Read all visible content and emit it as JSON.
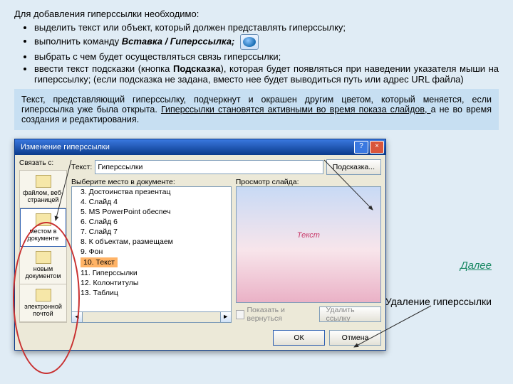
{
  "intro": {
    "title": "Для добавления гиперссылки необходимо:",
    "items": [
      "выделить текст или объект, который должен представлять гиперссылку;",
      "выполнить команду ",
      "выбрать с чем будет осуществляться связь гиперссылки;",
      "ввести текст подсказки (кнопка "
    ],
    "cmd": "Вставка / Гиперссылка;",
    "tipbtn": "Подсказка",
    "tiptail": "), которая будет появляться при наведении указателя мыши на гиперссылку; (если подсказка не задана, вместо нее будет выводиться путь или адрес URL файла)"
  },
  "note": {
    "t1": "Текст, представляющий гиперссылку, подчеркнут и окрашен другим цветом, который меняется, если гиперссылка уже была открыта. ",
    "t2": "Гиперссылки становятся активными во время показа слайдов, ",
    "t3": "а не во время создания и редактирования."
  },
  "dlg": {
    "title": "Изменение гиперссылки",
    "link_lbl": "Связать с:",
    "text_lbl": "Текст:",
    "text_val": "Гиперссылки",
    "tip_btn": "Подсказка...",
    "side": [
      {
        "l": "файлом, веб-\nстраницей"
      },
      {
        "l": "местом в\nдокументе"
      },
      {
        "l": "новым\nдокументом"
      },
      {
        "l": "электронной\nпочтой"
      }
    ],
    "tree_lbl": "Выберите место в документе:",
    "tree": [
      "3. Достоинства презентац",
      "4. Слайд 4",
      "5. MS PowerPoint обеспеч",
      "6. Слайд 6",
      "7. Слайд 7",
      "8. К объектам, размещаем",
      "9. Фон",
      "10. Текст",
      "11. Гиперссылки",
      "12. Колонтитулы",
      "13. Таблиц"
    ],
    "tree_sel": 7,
    "prev_lbl": "Просмотр слайда:",
    "prev_txt": "Текст",
    "chk_lbl": "Показать и вернуться",
    "del_btn": "Удалить ссылку",
    "ok": "ОК",
    "cancel": "Отмена"
  },
  "next": "Далее",
  "del_caption": "Удаление гиперссылки"
}
